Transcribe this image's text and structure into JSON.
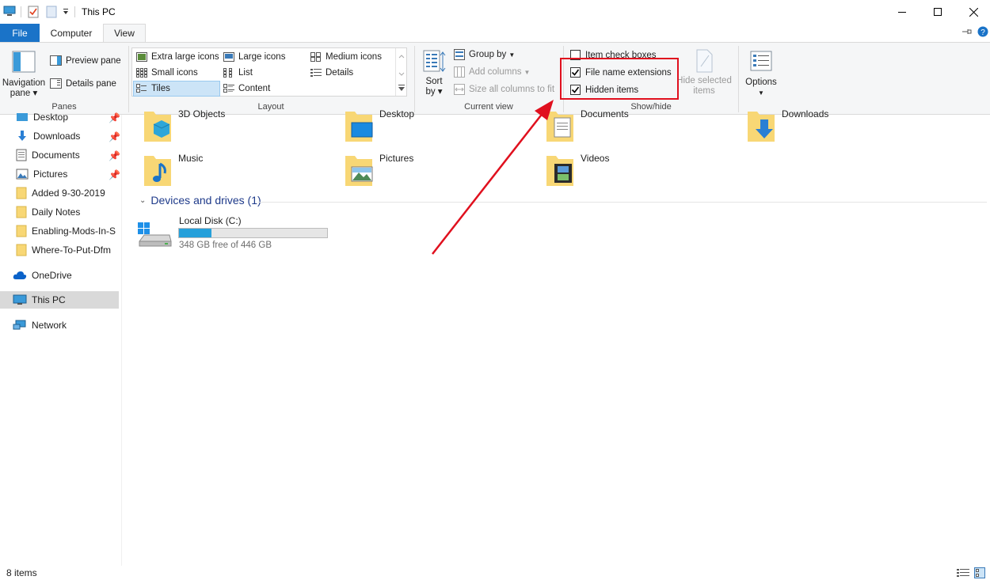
{
  "window": {
    "title": "This PC"
  },
  "tabs": {
    "file": "File",
    "computer": "Computer",
    "view": "View"
  },
  "ribbon": {
    "panes": {
      "label": "Panes",
      "navigation_pane_line1": "Navigation",
      "navigation_pane_line2": "pane",
      "preview_pane": "Preview pane",
      "details_pane": "Details pane"
    },
    "layout": {
      "label": "Layout",
      "items": [
        "Extra large icons",
        "Large icons",
        "Medium icons",
        "Small icons",
        "List",
        "Details",
        "Tiles",
        "Content"
      ],
      "selected": "Tiles"
    },
    "current_view": {
      "label": "Current view",
      "sort_by_line1": "Sort",
      "sort_by_line2": "by",
      "group_by": "Group by",
      "add_columns": "Add columns",
      "size_columns": "Size all columns to fit"
    },
    "show_hide": {
      "label": "Show/hide",
      "item_check_boxes": "Item check boxes",
      "item_check_boxes_checked": false,
      "file_name_extensions": "File name extensions",
      "file_name_extensions_checked": true,
      "hidden_items": "Hidden items",
      "hidden_items_checked": true,
      "hide_selected_line1": "Hide selected",
      "hide_selected_line2": "items"
    },
    "options": {
      "label": "Options"
    }
  },
  "nav": {
    "quick_access": [
      {
        "label": "Desktop",
        "pinned": true
      },
      {
        "label": "Downloads",
        "pinned": true
      },
      {
        "label": "Documents",
        "pinned": true
      },
      {
        "label": "Pictures",
        "pinned": true
      },
      {
        "label": "Added 9-30-2019",
        "pinned": false
      },
      {
        "label": "Daily Notes",
        "pinned": false
      },
      {
        "label": "Enabling-Mods-In-S",
        "pinned": false
      },
      {
        "label": "Where-To-Put-Dfm",
        "pinned": false
      }
    ],
    "onedrive": "OneDrive",
    "this_pc": "This PC",
    "network": "Network"
  },
  "content": {
    "folders": [
      "3D Objects",
      "Desktop",
      "Documents",
      "Downloads",
      "Music",
      "Pictures",
      "Videos"
    ],
    "devices_header": "Devices and drives (1)",
    "drive": {
      "name": "Local Disk (C:)",
      "free_text": "348 GB free of 446 GB",
      "used_fraction": 0.22
    }
  },
  "status": {
    "items_count": "8 items"
  },
  "colors": {
    "accent": "#1a73c8",
    "highlight": "#e0101e",
    "folder": "#f8d775",
    "drive_fill": "#26a0da"
  }
}
